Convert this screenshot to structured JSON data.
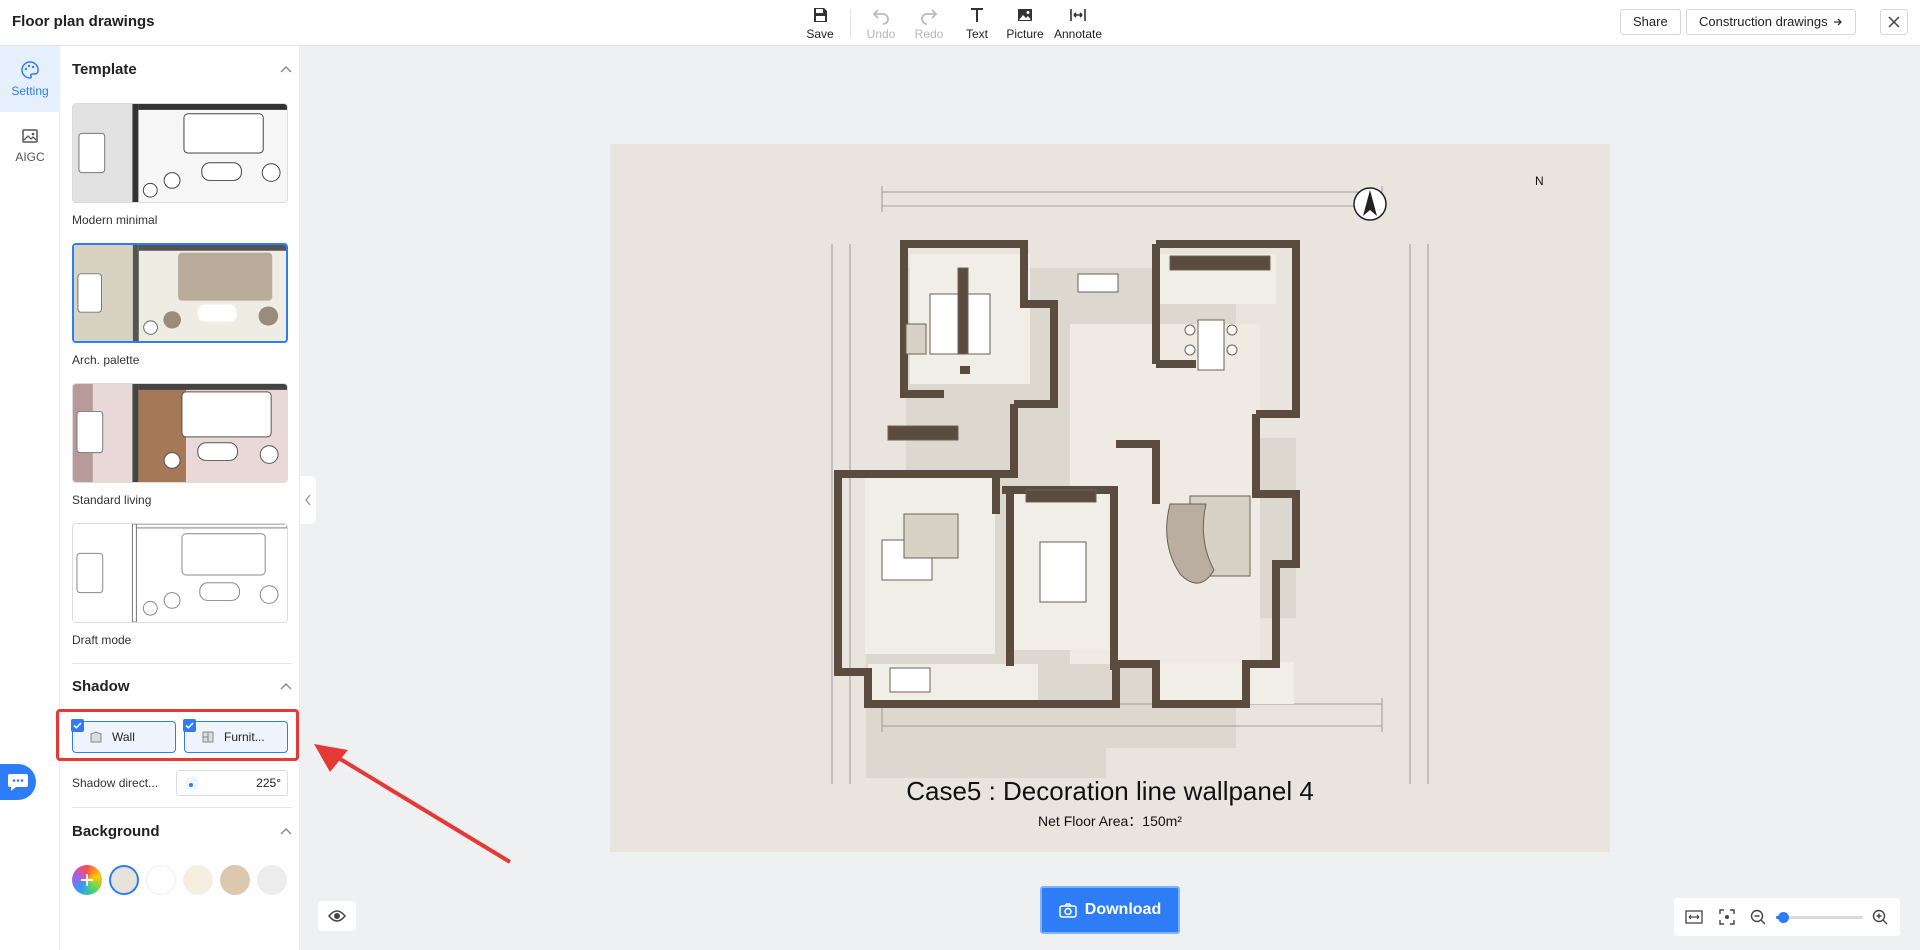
{
  "app_title": "Floor plan drawings",
  "toolbar": {
    "save": "Save",
    "undo": "Undo",
    "redo": "Redo",
    "text": "Text",
    "picture": "Picture",
    "annotate": "Annotate"
  },
  "header_actions": {
    "share": "Share",
    "construction": "Construction drawings"
  },
  "rail": [
    {
      "label": "Setting",
      "icon": "palette-icon",
      "active": true
    },
    {
      "label": "AIGC",
      "icon": "image-ai-icon",
      "active": false
    }
  ],
  "panel": {
    "template_title": "Template",
    "templates": [
      {
        "label": "Modern minimal",
        "selected": false
      },
      {
        "label": "Arch. palette",
        "selected": true
      },
      {
        "label": "Standard living",
        "selected": false
      },
      {
        "label": "Draft mode",
        "selected": false
      }
    ],
    "shadow_title": "Shadow",
    "shadow_options": [
      {
        "label": "Wall",
        "checked": true
      },
      {
        "label": "Furnit...",
        "checked": true
      }
    ],
    "shadow_direction_label": "Shadow direct...",
    "shadow_direction_value": "225°",
    "background_title": "Background",
    "background_swatches": [
      "#ffffff",
      "#e6e2dc",
      "#ffffff",
      "#f5efe1",
      "#dcc8ad",
      "#ededed"
    ],
    "background_selected": 1
  },
  "canvas": {
    "compass": "N",
    "title": "Case5 : Decoration line wallpanel 4",
    "area": "Net Floor Area：150m²",
    "background_color": "#e9e5de"
  },
  "download_label": "Download",
  "zoom_level": 0.08,
  "colors": {
    "accent": "#2f7df6",
    "highlight": "#e53935",
    "wall": "#5a4d40"
  }
}
